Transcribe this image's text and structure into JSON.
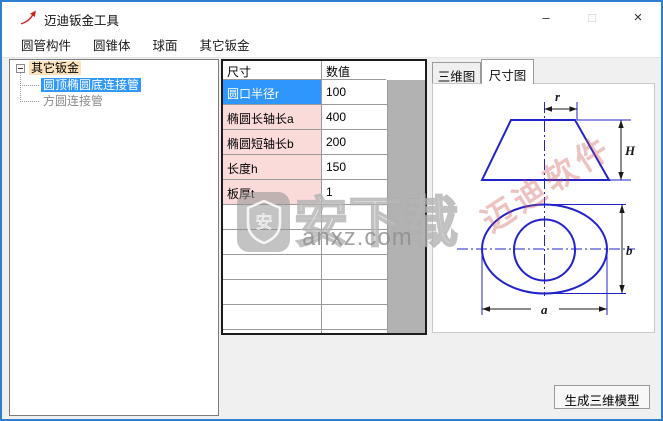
{
  "window": {
    "title": "迈迪钣金工具",
    "controls": {
      "minimize": "–",
      "maximize": "□",
      "close": "×"
    }
  },
  "menu": {
    "items": [
      {
        "label": "圆管构件"
      },
      {
        "label": "圆锥体"
      },
      {
        "label": "球面"
      },
      {
        "label": "其它钣金"
      }
    ]
  },
  "tree": {
    "root": "其它钣金",
    "children": [
      {
        "label": "圆顶椭圆底连接管",
        "selected": true
      },
      {
        "label": "方圆连接管",
        "selected": false
      }
    ]
  },
  "table": {
    "headers": [
      "尺寸",
      "数值"
    ],
    "rows": [
      {
        "label": "圆口半径r",
        "value": "100",
        "selected": true
      },
      {
        "label": "椭圆长轴长a",
        "value": "400",
        "selected": false
      },
      {
        "label": "椭圆短轴长b",
        "value": "200",
        "selected": false
      },
      {
        "label": "长度h",
        "value": "150",
        "selected": false
      },
      {
        "label": "板厚t",
        "value": "1",
        "selected": false
      }
    ]
  },
  "tabs": [
    {
      "label": "三维图",
      "active": false
    },
    {
      "label": "尺寸图",
      "active": true
    }
  ],
  "diagram": {
    "dim_r": "r",
    "dim_H": "H",
    "dim_a": "a",
    "dim_b": "b",
    "red_watermark": "迈迪软件"
  },
  "watermark": {
    "shield_char": "安",
    "outline_text": "安下载",
    "site": "anxz.com"
  },
  "footer": {
    "generate_button": "生成三维模型"
  },
  "colors": {
    "selection_blue": "#2e96fc",
    "row_pink": "#fbdada",
    "tree_root_highlight": "#fce3bd",
    "drawing_blue": "#2323cc",
    "app_icon_red": "#cc2418",
    "window_border_blue": "#2e7fd0",
    "grid_filler_gray": "#b2b2b2"
  }
}
